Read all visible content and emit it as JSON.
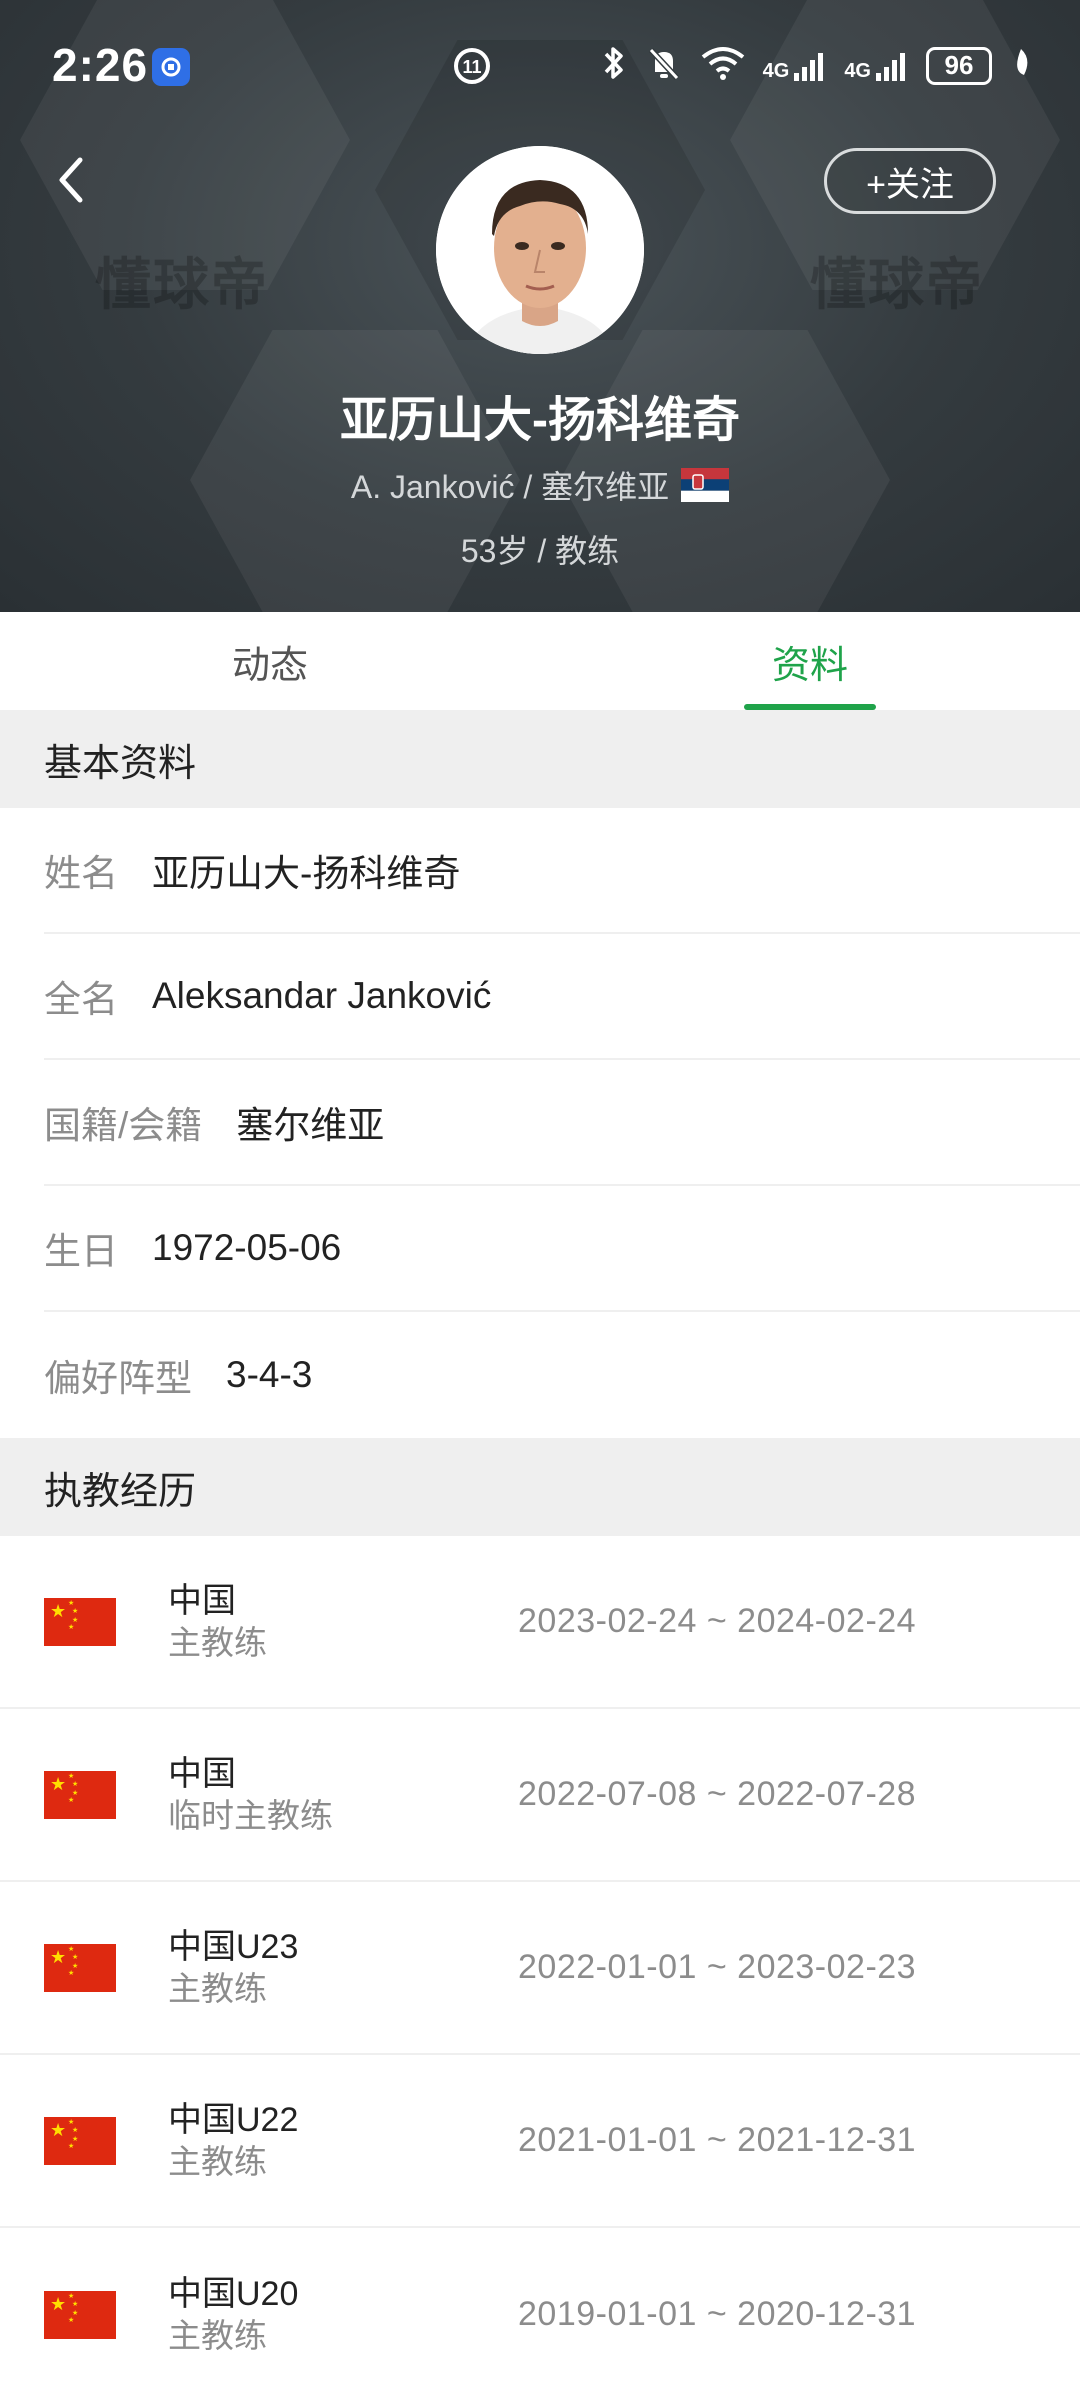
{
  "status_bar": {
    "time": "2:26",
    "net1": "4G",
    "net2": "4G",
    "battery": "96"
  },
  "header": {
    "follow_label": "+关注",
    "watermark": "懂球帝",
    "name": "亚历山大-扬科维奇",
    "subtitle": "A. Janković / 塞尔维亚",
    "meta": "53岁 / 教练"
  },
  "tabs": [
    {
      "label": "动态",
      "active": false
    },
    {
      "label": "资料",
      "active": true
    }
  ],
  "basic_info": {
    "title": "基本资料",
    "rows": [
      {
        "label": "姓名",
        "value": "亚历山大-扬科维奇"
      },
      {
        "label": "全名",
        "value": "Aleksandar Janković"
      },
      {
        "label": "国籍/会籍",
        "value": "塞尔维亚"
      },
      {
        "label": "生日",
        "value": "1972-05-06"
      },
      {
        "label": "偏好阵型",
        "value": "3-4-3"
      }
    ]
  },
  "coaching_history": {
    "title": "执教经历",
    "items": [
      {
        "team": "中国",
        "role": "主教练",
        "dates": "2023-02-24 ~ 2024-02-24"
      },
      {
        "team": "中国",
        "role": "临时主教练",
        "dates": "2022-07-08 ~ 2022-07-28"
      },
      {
        "team": "中国U23",
        "role": "主教练",
        "dates": "2022-01-01 ~ 2023-02-23"
      },
      {
        "team": "中国U22",
        "role": "主教练",
        "dates": "2021-01-01 ~ 2021-12-31"
      },
      {
        "team": "中国U20",
        "role": "主教练",
        "dates": "2019-01-01 ~ 2020-12-31"
      }
    ]
  },
  "colors": {
    "accent": "#1fa34a",
    "header_bg": "#343b3f",
    "section_bg": "#efefef",
    "flag_china": "#de2910"
  }
}
